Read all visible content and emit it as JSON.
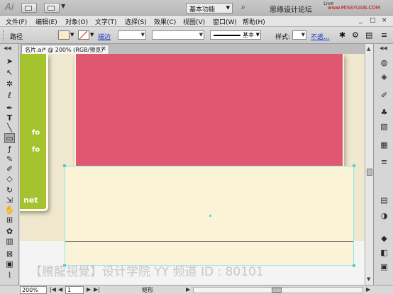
{
  "app": {
    "logo": "Ai"
  },
  "titlebar": {
    "workspace": "基本功能",
    "search_text": "思缘设计论坛",
    "search_sub": "www.MISSYUAN.COM",
    "live_label": "Live"
  },
  "menubar": {
    "items": [
      "文件(F)",
      "编辑(E)",
      "对象(O)",
      "文字(T)",
      "选择(S)",
      "效果(C)",
      "视图(V)",
      "窗口(W)",
      "帮助(H)"
    ],
    "win_controls": [
      "_",
      "□",
      "×"
    ]
  },
  "control_bar": {
    "object_type": "路径",
    "stroke_link": "描边",
    "stroke_profile": "基本",
    "style_label": "样式:",
    "opacity_link": "不透..."
  },
  "document": {
    "tab_label": "名片.ai* @ 200% (RGB/预览)",
    "close": "×"
  },
  "canvas": {
    "panel_texts": [
      "fo",
      "fo",
      "net"
    ],
    "watermark": "【騰龍視覺】设计学院 YY 频道 ID : 80101",
    "colors": {
      "pink": "#e05771",
      "green": "#a5c22f",
      "cream": "#faf3d6",
      "background": "#efe8cf",
      "selection": "#52d0d0"
    }
  },
  "status": {
    "zoom": "200%",
    "page": "1",
    "tool_name": "矩形"
  },
  "tools": [
    "selection-tool-icon",
    "direct-selection-tool-icon",
    "magic-wand-tool-icon",
    "lasso-tool-icon",
    "pen-tool-icon",
    "type-tool-icon",
    "line-tool-icon",
    "rectangle-tool-icon",
    "paintbrush-tool-icon",
    "pencil-tool-icon",
    "blob-brush-tool-icon",
    "eraser-tool-icon",
    "rotate-tool-icon",
    "scale-tool-icon",
    "warp-tool-icon",
    "free-transform-tool-icon",
    "symbol-sprayer-tool-icon",
    "column-graph-tool-icon",
    "mesh-tool-icon",
    "gradient-tool-icon",
    "eyedropper-tool-icon"
  ],
  "right_panels": [
    "color-panel-icon",
    "color-guide-panel-icon",
    "brushes-panel-icon",
    "symbols-panel-icon",
    "graphic-styles-panel-icon",
    "swatches-panel-icon",
    "stroke-panel-icon",
    "gradient-panel-icon",
    "transparency-panel-icon",
    "appearance-panel-icon",
    "layers-panel-icon",
    "artboards-panel-icon"
  ]
}
